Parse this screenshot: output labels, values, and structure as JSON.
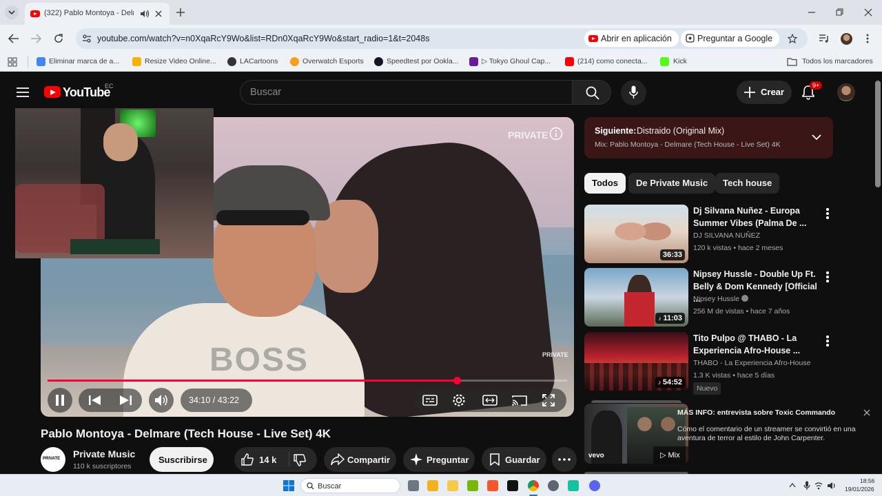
{
  "browser": {
    "tab_title": "(322) Pablo Montoya - Delm",
    "url": "youtube.com/watch?v=n0XqaRcY9Wo&list=RDn0XqaRcY9Wo&start_radio=1&t=2048s",
    "open_app_label": "Abrir en aplicación",
    "ask_google_label": "Preguntar a Google",
    "bookmarks": [
      {
        "label": "Eliminar marca de a...",
        "color": "#4285f4"
      },
      {
        "label": "Resize Video Online...",
        "color": "#f4b400"
      },
      {
        "label": "LACartoons",
        "color": "#333333"
      },
      {
        "label": "Overwatch Esports",
        "color": "#f99e1a"
      },
      {
        "label": "Speedtest por Ookla...",
        "color": "#141526"
      },
      {
        "label": "▷ Tokyo Ghoul Cap...",
        "color": "#6a1b9a"
      },
      {
        "label": "(214) como conecta...",
        "color": "#ff0000"
      },
      {
        "label": "Kick",
        "color": "#53fc18"
      }
    ],
    "all_bookmarks_label": "Todos los marcadores"
  },
  "youtube": {
    "logo_text": "YouTube",
    "country": "EC",
    "search_placeholder": "Buscar",
    "create_label": "Crear",
    "notif_badge": "9+",
    "player": {
      "watermark": "PRIVATE",
      "watermark_small": "PRIVATE",
      "shirt_text": "BOSS",
      "time": "34:10 / 43:22",
      "progress": 0.788
    },
    "video_title": "Pablo Montoya - Delmare (Tech House - Live Set) 4K",
    "channel": {
      "avatar_text": "PRIVATE",
      "name": "Private Music",
      "subs": "110 k suscriptores",
      "subscribe_label": "Suscribirse"
    },
    "actions": {
      "likes": "14 k",
      "share": "Compartir",
      "ask": "Preguntar",
      "save": "Guardar"
    },
    "up_next": {
      "prefix": "Siguiente:",
      "title": "Distraido (Original Mix)",
      "subtitle": "Mix: Pablo Montoya - Delmare (Tech House - Live Set) 4K"
    },
    "chips": [
      "Todos",
      "De Private Music",
      "Tech house"
    ],
    "videos": [
      {
        "title": "Dj Silvana Nuñez - Europa Summer Vibes (Palma De ...",
        "channel": "DJ SILVANA NUÑEZ",
        "meta": "120 k vistas • hace 2 meses",
        "duration": "36:33"
      },
      {
        "title": "Nipsey Hussle - Double Up Ft. Belly & Dom Kennedy [Official ...",
        "channel": "Nipsey Hussle",
        "meta": "256 M de vistas • hace 7 años",
        "duration": "11:03"
      },
      {
        "title": "Tito Pulpo @ THABO - La Experiencia Afro-House ...",
        "channel": "THABO - La Experiencia Afro-House",
        "meta": "1.3 K vistas • hace 5 días",
        "duration": "54:52",
        "badge": "Nuevo"
      }
    ],
    "promo": {
      "title": "MÁS INFO: entrevista sobre Toxic Commando",
      "body": "Cómo el comentario de un streamer se convirtió en una aventura de terror al estilo de John Carpenter.",
      "mix_label": "Mix",
      "vevo": "vevo"
    }
  },
  "taskbar": {
    "search_label": "Buscar",
    "time": "18:56",
    "date": "19/01/2026"
  },
  "colors": {
    "accent_red": "#ff0033",
    "yt_bg": "#0f0f0f"
  }
}
